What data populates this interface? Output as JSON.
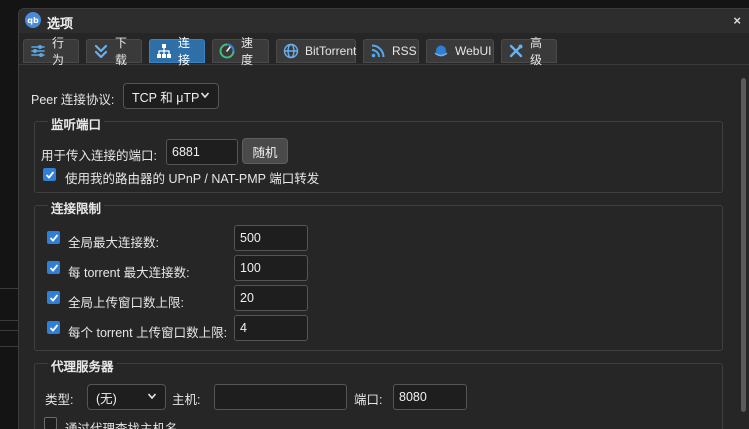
{
  "window": {
    "title": "选项",
    "close": "×",
    "app_icon": "qb"
  },
  "tabs": [
    {
      "label": "行为",
      "icon": "sliders-icon"
    },
    {
      "label": "下载",
      "icon": "chevrons-down-icon"
    },
    {
      "label": "连接",
      "icon": "network-icon",
      "active": true
    },
    {
      "label": "速度",
      "icon": "speedometer-icon"
    },
    {
      "label": "BitTorrent",
      "icon": "globe-icon"
    },
    {
      "label": "RSS",
      "icon": "rss-icon"
    },
    {
      "label": "WebUI",
      "icon": "webui-icon"
    },
    {
      "label": "高级",
      "icon": "tools-icon"
    }
  ],
  "peer": {
    "label": "Peer 连接协议:",
    "value": "TCP 和 μTP"
  },
  "listen": {
    "legend": "监听端口",
    "port_label": "用于传入连接的端口:",
    "port_value": "6881",
    "random_button": "随机",
    "upnp_label": "使用我的路由器的 UPnP / NAT-PMP 端口转发",
    "upnp_checked": true
  },
  "limits": {
    "legend": "连接限制",
    "rows": [
      {
        "label": "全局最大连接数:",
        "value": "500",
        "checked": true
      },
      {
        "label": "每 torrent 最大连接数:",
        "value": "100",
        "checked": true
      },
      {
        "label": "全局上传窗口数上限:",
        "value": "20",
        "checked": true
      },
      {
        "label": "每个 torrent 上传窗口数上限:",
        "value": "4",
        "checked": true
      }
    ]
  },
  "proxy": {
    "legend": "代理服务器",
    "type_label": "类型:",
    "type_value": "(无)",
    "host_label": "主机:",
    "host_value": "",
    "port_label": "端口:",
    "port_value": "8080",
    "lookup_label": "通过代理查找主机名",
    "lookup_checked": false
  },
  "colors": {
    "accent": "#2f7ed8",
    "active_tab": "#2f6fa8",
    "window_bg": "#262626"
  }
}
